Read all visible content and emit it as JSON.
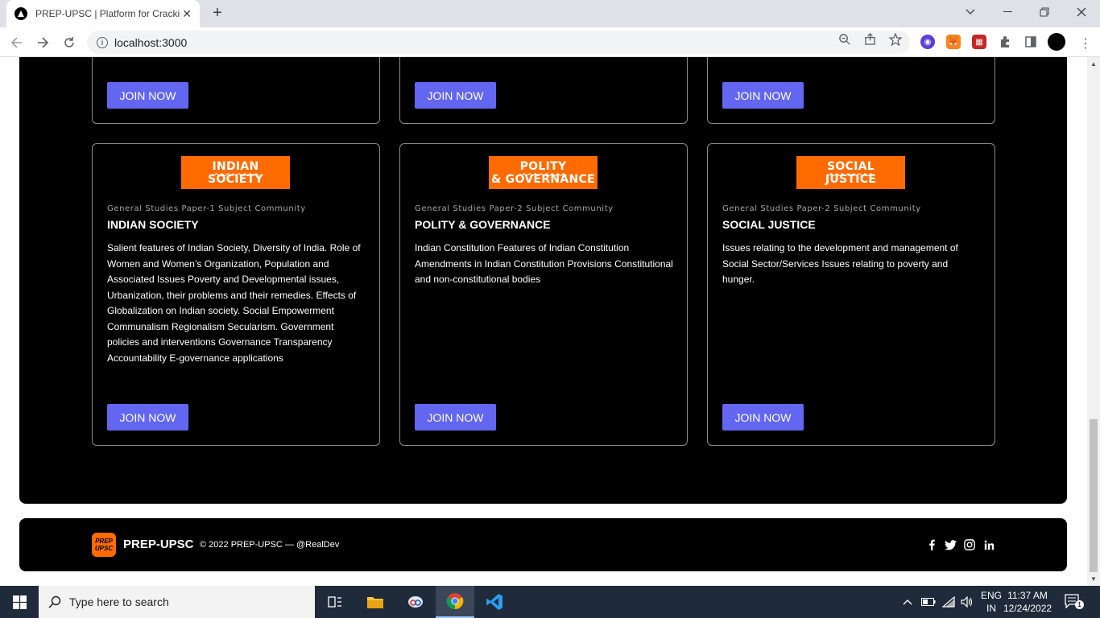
{
  "browser": {
    "tab_title": "PREP-UPSC | Platform for Cracking UPSC",
    "url": "localhost:3000",
    "window_controls": [
      "chevron-down-icon",
      "minimize-icon",
      "restore-icon",
      "close-icon"
    ]
  },
  "top_row": {
    "buttons": [
      "JOIN NOW",
      "JOIN NOW",
      "JOIN NOW"
    ]
  },
  "cards": [
    {
      "badge_line1": "INDIAN",
      "badge_line2": "SOCIETY",
      "kicker": "General Studies Paper-1 Subject Community",
      "title": "INDIAN SOCIETY",
      "description": "Salient features of Indian Society, Diversity of India. Role of Women and Women’s Organization, Population and Associated Issues Poverty and Developmental issues, Urbanization, their problems and their remedies. Effects of Globalization on Indian society. Social Empowerment Communalism Regionalism Secularism. Government policies and interventions Governance Transparency Accountability E-governance applications",
      "button": "JOIN NOW"
    },
    {
      "badge_line1": "POLITY",
      "badge_line2": "& GOVERNANCE",
      "kicker": "General Studies Paper-2 Subject Community",
      "title": "POLITY & GOVERNANCE",
      "description": "Indian Constitution Features of Indian Constitution Amendments in Indian Constitution Provisions Constitutional and non-constitutional bodies",
      "button": "JOIN NOW"
    },
    {
      "badge_line1": "SOCIAL",
      "badge_line2": "JUSTICE",
      "kicker": "General Studies Paper-2 Subject Community",
      "title": "SOCIAL JUSTICE",
      "description": "Issues relating to the development and management of Social Sector/Services Issues relating to poverty and hunger.",
      "button": "JOIN NOW"
    }
  ],
  "footer": {
    "logo_line1": "PREP",
    "logo_line2": "UPSC",
    "brand": "PREP-UPSC",
    "copyright": "© 2022 PREP-UPSC — @RealDev",
    "social": [
      "facebook-icon",
      "twitter-icon",
      "instagram-icon",
      "linkedin-icon"
    ]
  },
  "taskbar": {
    "search_placeholder": "Type here to search",
    "lang_line1": "ENG",
    "lang_line2": "IN",
    "time": "11:37 AM",
    "date": "12/24/2022",
    "notification_count": "1"
  },
  "colors": {
    "accent_button": "#6366f1",
    "badge_orange": "#ff6b00",
    "section_bg": "#000000"
  }
}
